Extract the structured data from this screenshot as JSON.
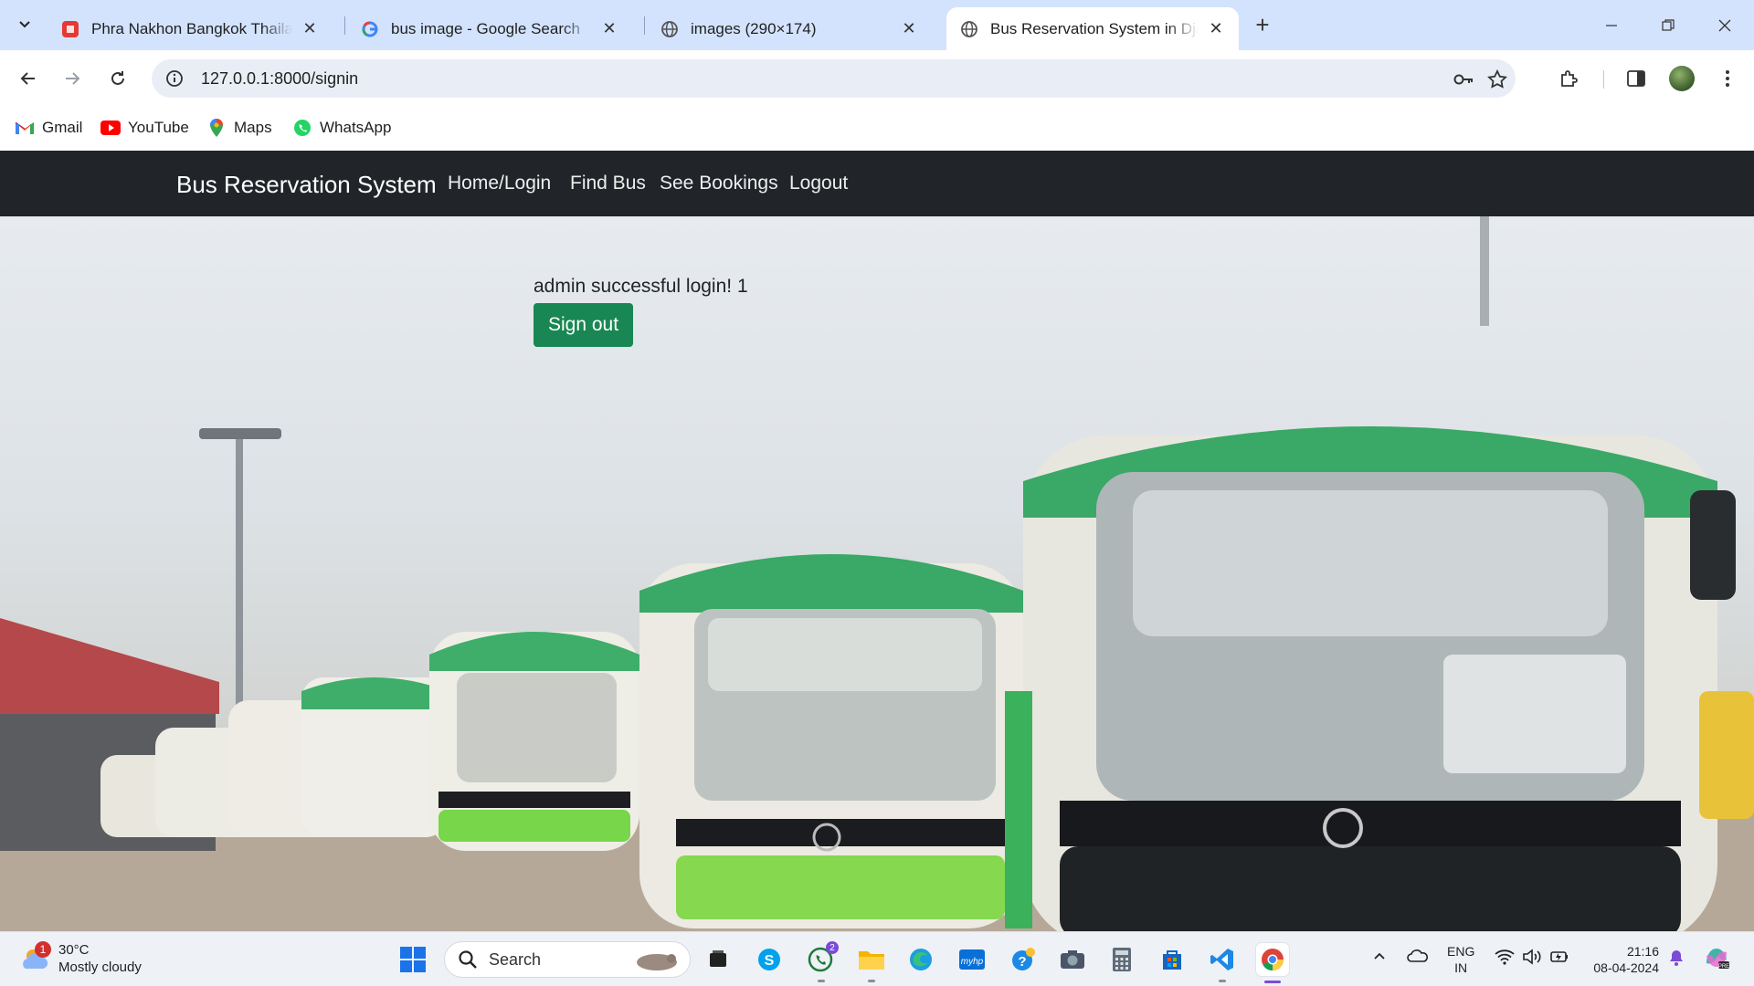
{
  "tabs": [
    {
      "title": "Phra Nakhon Bangkok Thailand",
      "favicon": "red-app-icon"
    },
    {
      "title": "bus image - Google Search",
      "favicon": "google-g-icon"
    },
    {
      "title": "images (290×174)",
      "favicon": "globe-icon"
    },
    {
      "title": "Bus Reservation System in Django",
      "favicon": "globe-icon",
      "active": true
    }
  ],
  "address_bar": {
    "url": "127.0.0.1:8000/signin"
  },
  "bookmarks": [
    {
      "label": "Gmail",
      "icon": "gmail-icon"
    },
    {
      "label": "YouTube",
      "icon": "youtube-icon"
    },
    {
      "label": "Maps",
      "icon": "maps-pin-icon"
    },
    {
      "label": "WhatsApp",
      "icon": "whatsapp-icon"
    }
  ],
  "site": {
    "brand": "Bus Reservation System",
    "nav": [
      "Home/Login",
      "Find Bus",
      "See Bookings",
      "Logout"
    ],
    "message": "admin successful login! 1",
    "signout_label": "Sign out",
    "colors": {
      "navbar": "#212529",
      "button": "#198754"
    }
  },
  "taskbar": {
    "weather": {
      "temp": "30°C",
      "condition": "Mostly cloudy",
      "badge": "1"
    },
    "search_label": "Search",
    "whatsapp_badge": "2",
    "lang_line1": "ENG",
    "lang_line2": "IN",
    "time": "21:16",
    "date": "08-04-2024"
  }
}
